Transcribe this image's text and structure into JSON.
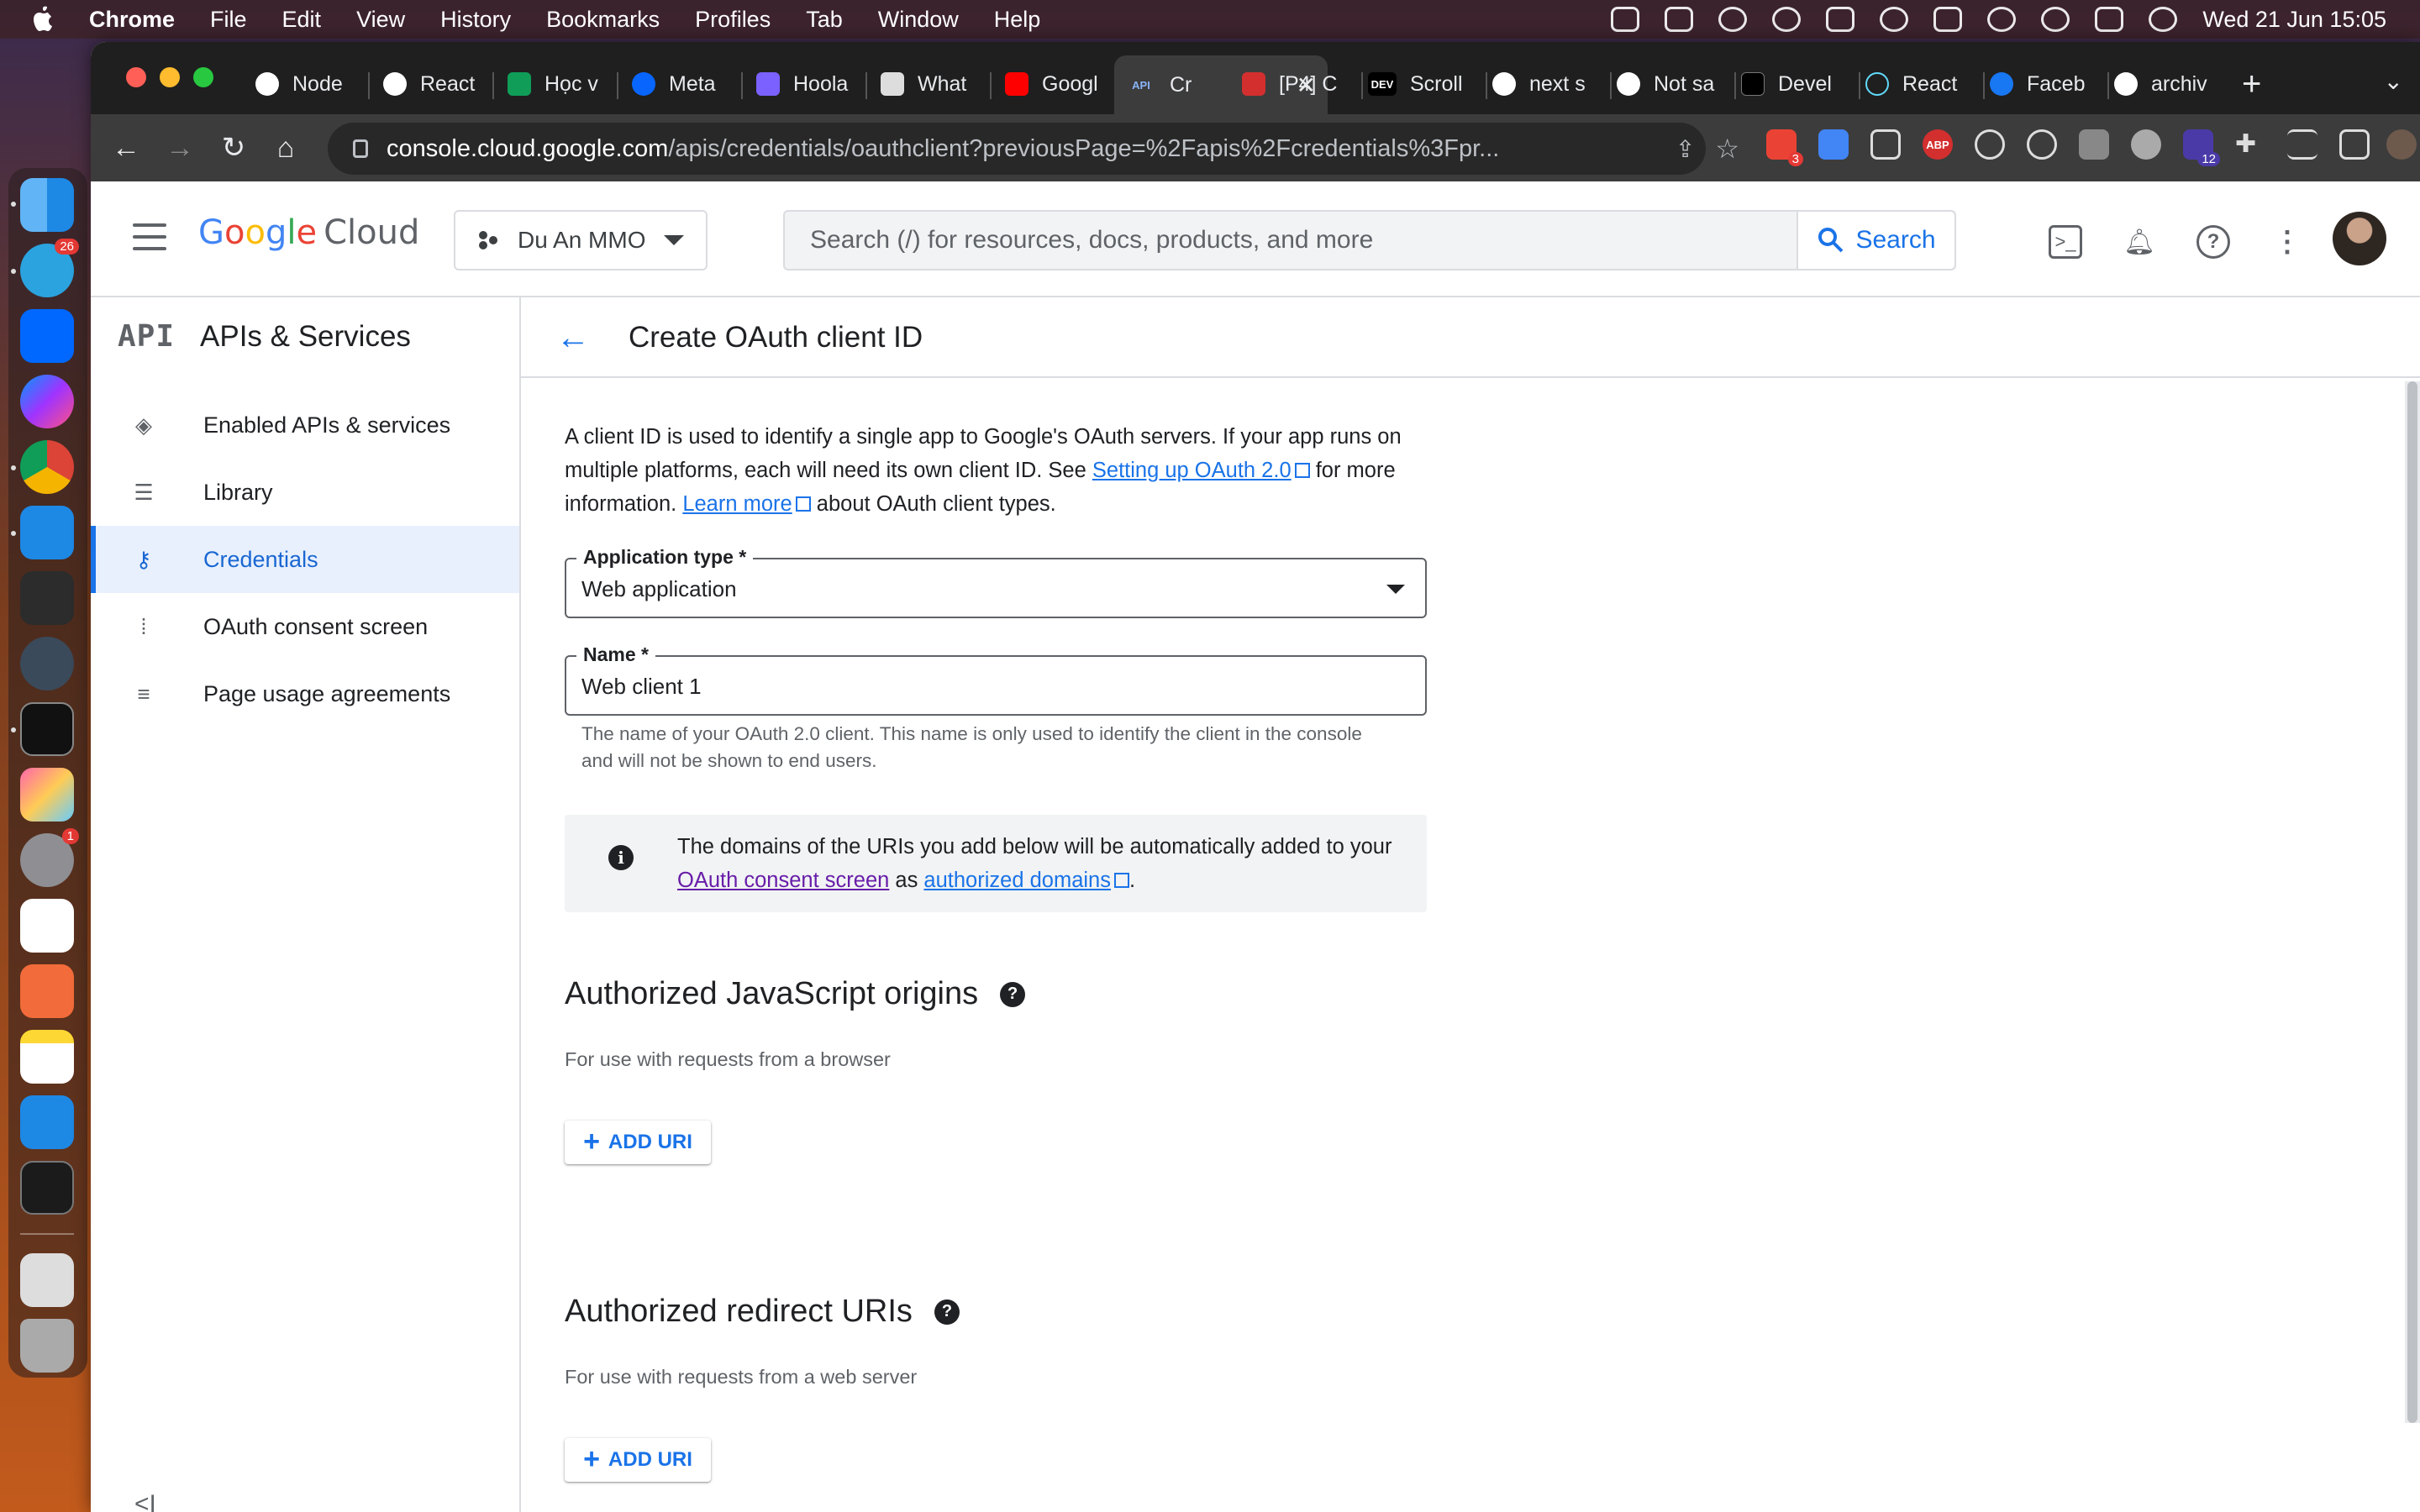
{
  "menubar": {
    "app": "Chrome",
    "items": [
      "File",
      "Edit",
      "View",
      "History",
      "Bookmarks",
      "Profiles",
      "Tab",
      "Window",
      "Help"
    ],
    "clock": "Wed 21 Jun  15:05"
  },
  "dock": {
    "telegram_badge": "26",
    "settings_badge": "1"
  },
  "tabs": [
    "Node",
    "React",
    "Học v",
    "Meta",
    "Hoola",
    "What",
    "Googl",
    "Cr",
    "[P4] C",
    "Scroll",
    "next s",
    "Not sa",
    "Devel",
    "React",
    "Faceb",
    "archiv"
  ],
  "tab_icons": {
    "api": "API",
    "dev": "DEV"
  },
  "address": {
    "host": "console.cloud.google.com",
    "path": "/apis/credentials/oauthclient?previousPage=%2Fapis%2Fcredentials%3Fpr..."
  },
  "extensions": {
    "gmail_badge": "3",
    "badge_12": "12",
    "abp": "ABP"
  },
  "header": {
    "logo_google": [
      "G",
      "o",
      "o",
      "g",
      "l",
      "e"
    ],
    "logo_cloud": "Cloud",
    "project": "Du An MMO",
    "search_placeholder": "Search (/) for resources, docs, products, and more",
    "search_button": "Search"
  },
  "sidebar": {
    "badge": "API",
    "title": "APIs & Services",
    "items": [
      {
        "label": "Enabled APIs & services"
      },
      {
        "label": "Library"
      },
      {
        "label": "Credentials"
      },
      {
        "label": "OAuth consent screen"
      },
      {
        "label": "Page usage agreements"
      }
    ],
    "collapse_glyph": "<I"
  },
  "page": {
    "title": "Create OAuth client ID",
    "intro": {
      "part1": "A client ID is used to identify a single app to Google's OAuth servers. If your app runs on multiple platforms, each will need its own client ID. See ",
      "link1": "Setting up OAuth 2.0",
      "part2": " for more information. ",
      "link2": "Learn more",
      "part3": " about OAuth client types."
    },
    "app_type": {
      "label": "Application type *",
      "value": "Web application"
    },
    "name_field": {
      "label": "Name *",
      "value": "Web client 1"
    },
    "name_helper": "The name of your OAuth 2.0 client. This name is only used to identify the client in the console and will not be shown to end users.",
    "info": {
      "part1": "The domains of the URIs you add below will be automatically added to your ",
      "link1": "OAuth consent screen",
      "part2": " as ",
      "link2": "authorized domains",
      "part3": "."
    },
    "js_origins": {
      "title": "Authorized JavaScript origins",
      "subtitle": "For use with requests from a browser",
      "button": "ADD URI"
    },
    "redirect_uris": {
      "title": "Authorized redirect URIs",
      "subtitle": "For use with requests from a web server",
      "button": "ADD URI"
    }
  },
  "colors": {
    "accent": "#1a73e8",
    "active_nav_bg": "#e8f0fe",
    "visited_link": "#681da8"
  }
}
